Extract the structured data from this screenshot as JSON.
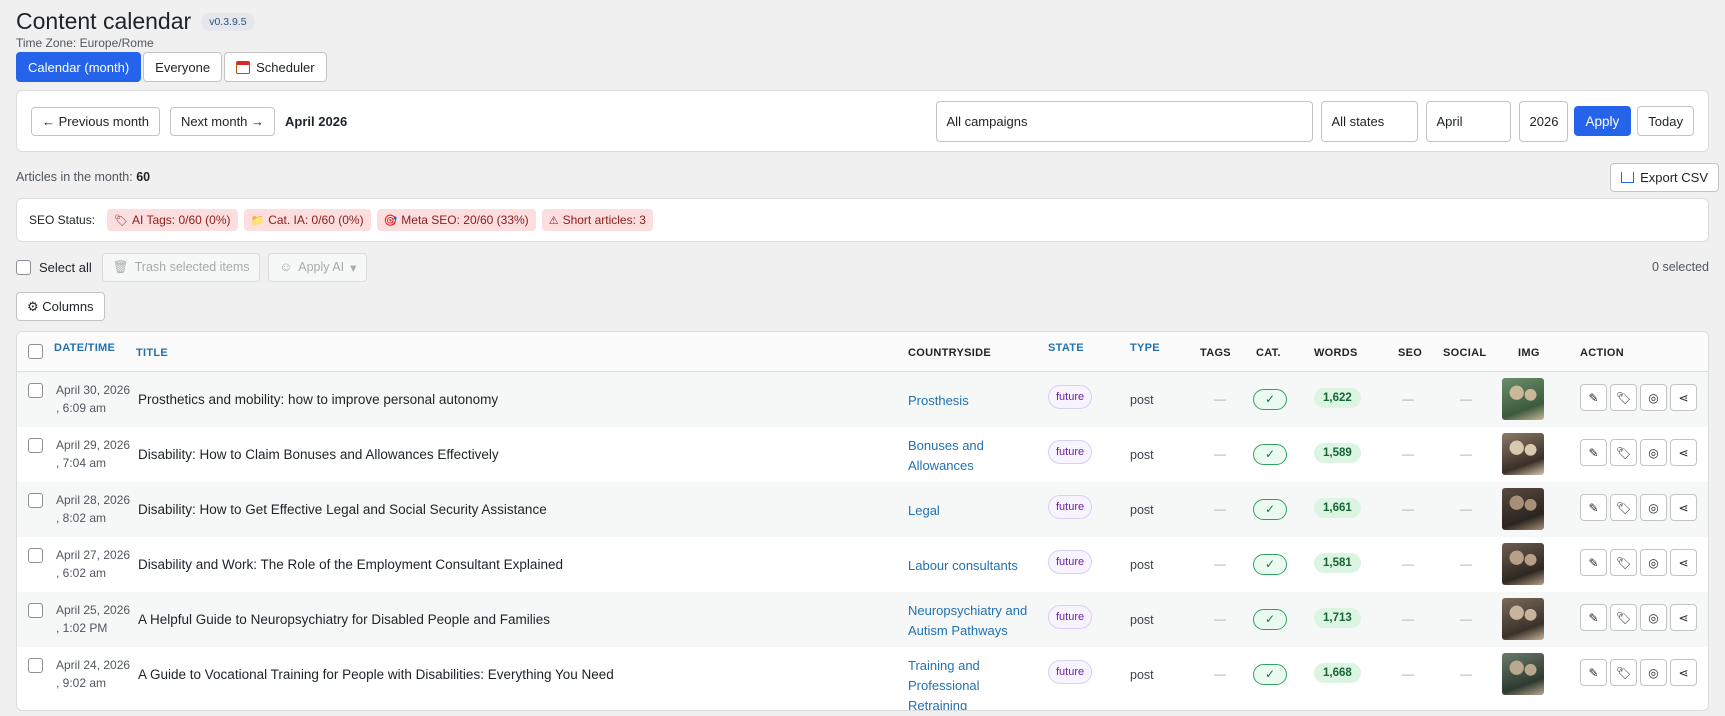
{
  "header": {
    "title": "Content calendar",
    "version": "v0.3.9.5",
    "timezone": "Time Zone: Europe/Rome"
  },
  "view_tabs": [
    {
      "label": "Calendar (month)",
      "active": true
    },
    {
      "label": "Everyone",
      "active": false
    },
    {
      "label": "Scheduler",
      "active": false,
      "icon": "calendar-icon"
    }
  ],
  "navigation": {
    "prev_label": "← Previous month",
    "next_label": "Next month →",
    "current_month": "April 2026",
    "campaign_select": "All campaigns",
    "state_select": "All states",
    "month_select": "April",
    "year_select": "2026",
    "apply_label": "Apply",
    "today_label": "Today"
  },
  "stats": {
    "articles_label": "Articles in the month:",
    "articles_count": "60",
    "export_label": "Export CSV"
  },
  "seo_status": {
    "label": "SEO Status:",
    "chips": [
      {
        "icon": "tag-icon",
        "glyph": "🏷",
        "text": "AI Tags: 0/60 (0%)"
      },
      {
        "icon": "folder-icon",
        "glyph": "📁",
        "text": "Cat. IA: 0/60 (0%)"
      },
      {
        "icon": "target-icon",
        "glyph": "🎯",
        "text": "Meta SEO: 20/60 (33%)"
      },
      {
        "icon": "warning-icon",
        "glyph": "⚠",
        "text": "Short articles: 3"
      }
    ]
  },
  "bulk": {
    "select_all_label": "Select all",
    "trash_label": "Trash selected items",
    "apply_ai_label": "Apply AI",
    "selected_count": "0 selected"
  },
  "columns_button": "⚙ Columns",
  "table": {
    "headers": {
      "date": "DATE/TIME",
      "title": "TITLE",
      "category": "COUNTRYSIDE",
      "state": "STATE",
      "type": "TYPE",
      "tags": "TAGS",
      "cat": "CAT.",
      "words": "WORDS",
      "seo": "SEO",
      "social": "SOCIAL",
      "img": "IMG",
      "action": "ACTION"
    },
    "rows": [
      {
        "date": "April 30, 2026",
        "time": ", 6:09 am",
        "title": "Prosthetics and mobility: how to improve personal autonomy",
        "category": "Prosthesis",
        "state": "future",
        "type": "post",
        "tags": "—",
        "cat": "✓",
        "words": "1,622",
        "seo": "—",
        "social": "—",
        "thumb_colors": [
          "#6b8e6b",
          "#3d5a3d",
          "#c9b89a"
        ]
      },
      {
        "date": "April 29, 2026",
        "time": ", 7:04 am",
        "title": "Disability: How to Claim Bonuses and Allowances Effectively",
        "category": "Bonuses and Allowances",
        "state": "future",
        "type": "post",
        "tags": "—",
        "cat": "✓",
        "words": "1,589",
        "seo": "—",
        "social": "—",
        "thumb_colors": [
          "#8a7a66",
          "#3a3028",
          "#d8c8b0"
        ]
      },
      {
        "date": "April 28, 2026",
        "time": ", 8:02 am",
        "title": "Disability: How to Get Effective Legal and Social Security Assistance",
        "category": "Legal",
        "state": "future",
        "type": "post",
        "tags": "—",
        "cat": "✓",
        "words": "1,661",
        "seo": "—",
        "social": "—",
        "thumb_colors": [
          "#5a4a3e",
          "#2a2420",
          "#a89078"
        ]
      },
      {
        "date": "April 27, 2026",
        "time": ", 6:02 am",
        "title": "Disability and Work: The Role of the Employment Consultant Explained",
        "category": "Labour consultants",
        "state": "future",
        "type": "post",
        "tags": "—",
        "cat": "✓",
        "words": "1,581",
        "seo": "—",
        "social": "—",
        "thumb_colors": [
          "#6e5e50",
          "#2e2822",
          "#b8a088"
        ]
      },
      {
        "date": "April 25, 2026",
        "time": ", 1:02 PM",
        "title": "A Helpful Guide to Neuropsychiatry for Disabled People and Families",
        "category": "Neuropsychiatry and Autism Pathways",
        "state": "future",
        "type": "post",
        "tags": "—",
        "cat": "✓",
        "words": "1,713",
        "seo": "—",
        "social": "—",
        "thumb_colors": [
          "#7a6a5a",
          "#3a322a",
          "#c8b49c"
        ]
      },
      {
        "date": "April 24, 2026",
        "time": ", 9:02 am",
        "title": "A Guide to Vocational Training for People with Disabilities: Everything You Need",
        "category": "Training and Professional Retraining",
        "state": "future",
        "type": "post",
        "tags": "—",
        "cat": "✓",
        "words": "1,668",
        "seo": "—",
        "social": "—",
        "thumb_colors": [
          "#6a7a6a",
          "#2e3a30",
          "#b8a890"
        ]
      }
    ],
    "action_icons": [
      {
        "name": "edit-icon",
        "glyph": "✎"
      },
      {
        "name": "tag-icon",
        "glyph": "🏷"
      },
      {
        "name": "seo-icon",
        "glyph": "◎"
      },
      {
        "name": "share-icon",
        "glyph": "⋖"
      }
    ]
  }
}
